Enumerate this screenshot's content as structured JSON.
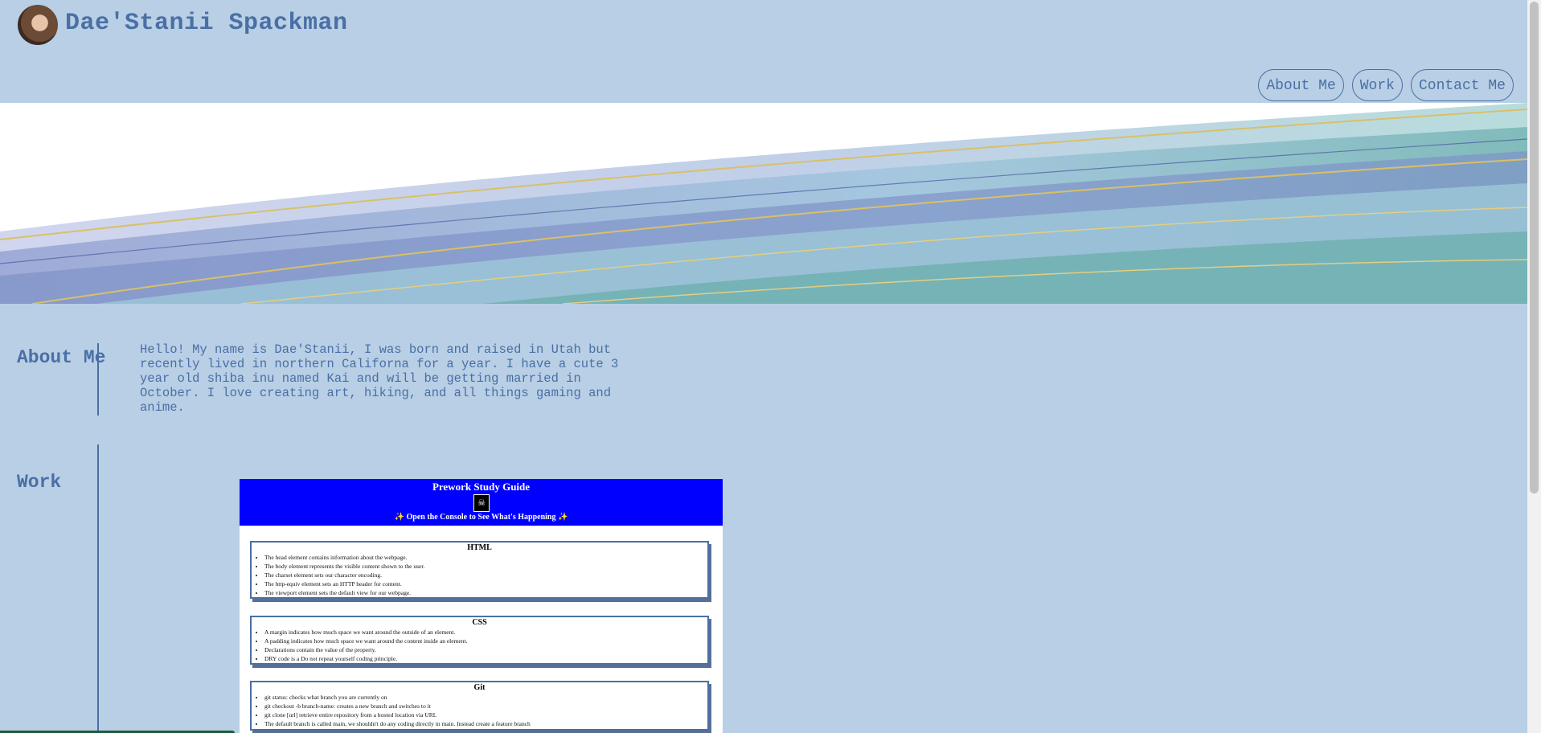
{
  "header": {
    "site_title": "Dae'Stanii Spackman",
    "nav": [
      {
        "label": "About Me"
      },
      {
        "label": "Work"
      },
      {
        "label": "Contact Me"
      }
    ]
  },
  "about": {
    "title": "About Me",
    "text": "Hello! My name is Dae'Stanii, I was born and raised in Utah but recently lived in northern Californa for a year. I have a cute 3 year old shiba inu named Kai and will be getting married in October. I love creating art, hiking, and all things gaming and anime."
  },
  "work": {
    "title": "Work",
    "study_guide": {
      "title": "Prework Study Guide",
      "subtitle": "✨ Open the Console to See What's Happening ✨",
      "topics": [
        {
          "heading": "HTML",
          "items": [
            "The head element contains information about the webpage.",
            "The body element represents the visible content shown to the user.",
            "The charset element sets our character encoding.",
            "The http-equiv element sets an HTTP header for content.",
            "The viewport element sets the default view for our webpage."
          ]
        },
        {
          "heading": "CSS",
          "items": [
            "A margin indicates how much space we want around the outside of an element.",
            "A padding indicates how much space we want around the content inside an element.",
            "Declarations contain the value of the property.",
            "DRY code is a Do not repeat yourself coding principle."
          ]
        },
        {
          "heading": "Git",
          "items": [
            "git status: checks what branch you are currently on",
            "git checkout -b branch-name: creates a new branch and switches to it",
            "git clone [url] retrieve entire repository from a hosted location via URL",
            "The default branch is called main, we shouldn't do any coding directly in main. Instead create a feature branch"
          ]
        }
      ]
    }
  },
  "colors": {
    "background": "#b8cfe5",
    "accent": "#4a6fa5",
    "study_header": "#0000ff"
  }
}
